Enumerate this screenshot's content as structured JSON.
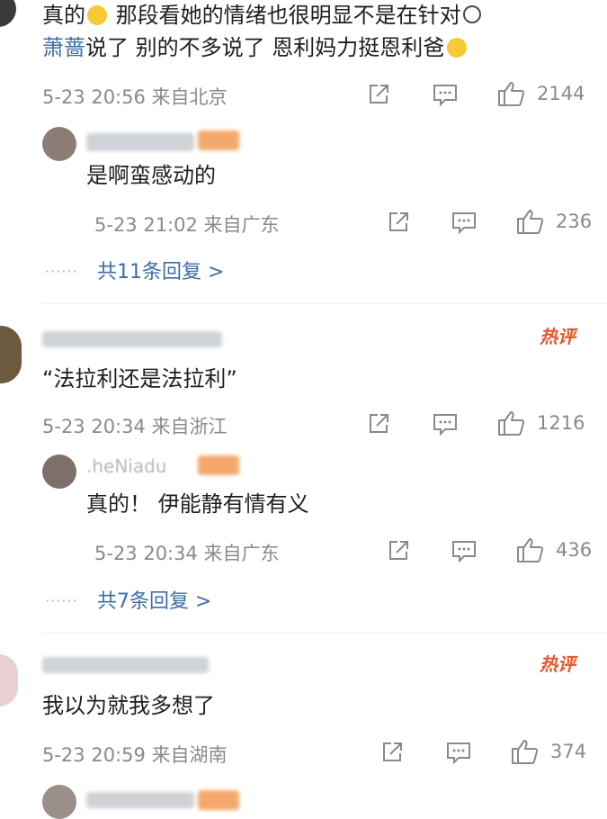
{
  "top_comment": {
    "text_part1": "真的",
    "text_part2": " 那段看她的情绪也很明显不是在针对",
    "text_line2_link": "萧蔷",
    "text_line2": "说了 别的不多说了 恩利妈力挺恩利爸",
    "meta": "5-23 20:56 来自北京",
    "likes": "2144"
  },
  "reply1": {
    "text": "是啊蛮感动的",
    "meta": "5-23 21:02 来自广东",
    "likes": "236"
  },
  "more1": {
    "dots": "······",
    "label": "共11条回复 >"
  },
  "comment2": {
    "badge": "热评",
    "text": "“法拉利还是法拉利”",
    "meta": "5-23 20:34 来自浙江",
    "likes": "1216"
  },
  "reply2": {
    "user_fragment": ".heNiadu",
    "text": "真的！ 伊能静有情有义",
    "meta": "5-23 20:34 来自广东",
    "likes": "436"
  },
  "more2": {
    "dots": "······",
    "label": "共7条回复 >"
  },
  "comment3": {
    "badge": "热评",
    "text": "我以为就我多想了",
    "meta": "5-23 20:59 来自湖南",
    "likes": "374"
  },
  "colors": {
    "link": "#3b6ea8",
    "hot": "#e8542a",
    "meta": "#8a8a8a"
  }
}
